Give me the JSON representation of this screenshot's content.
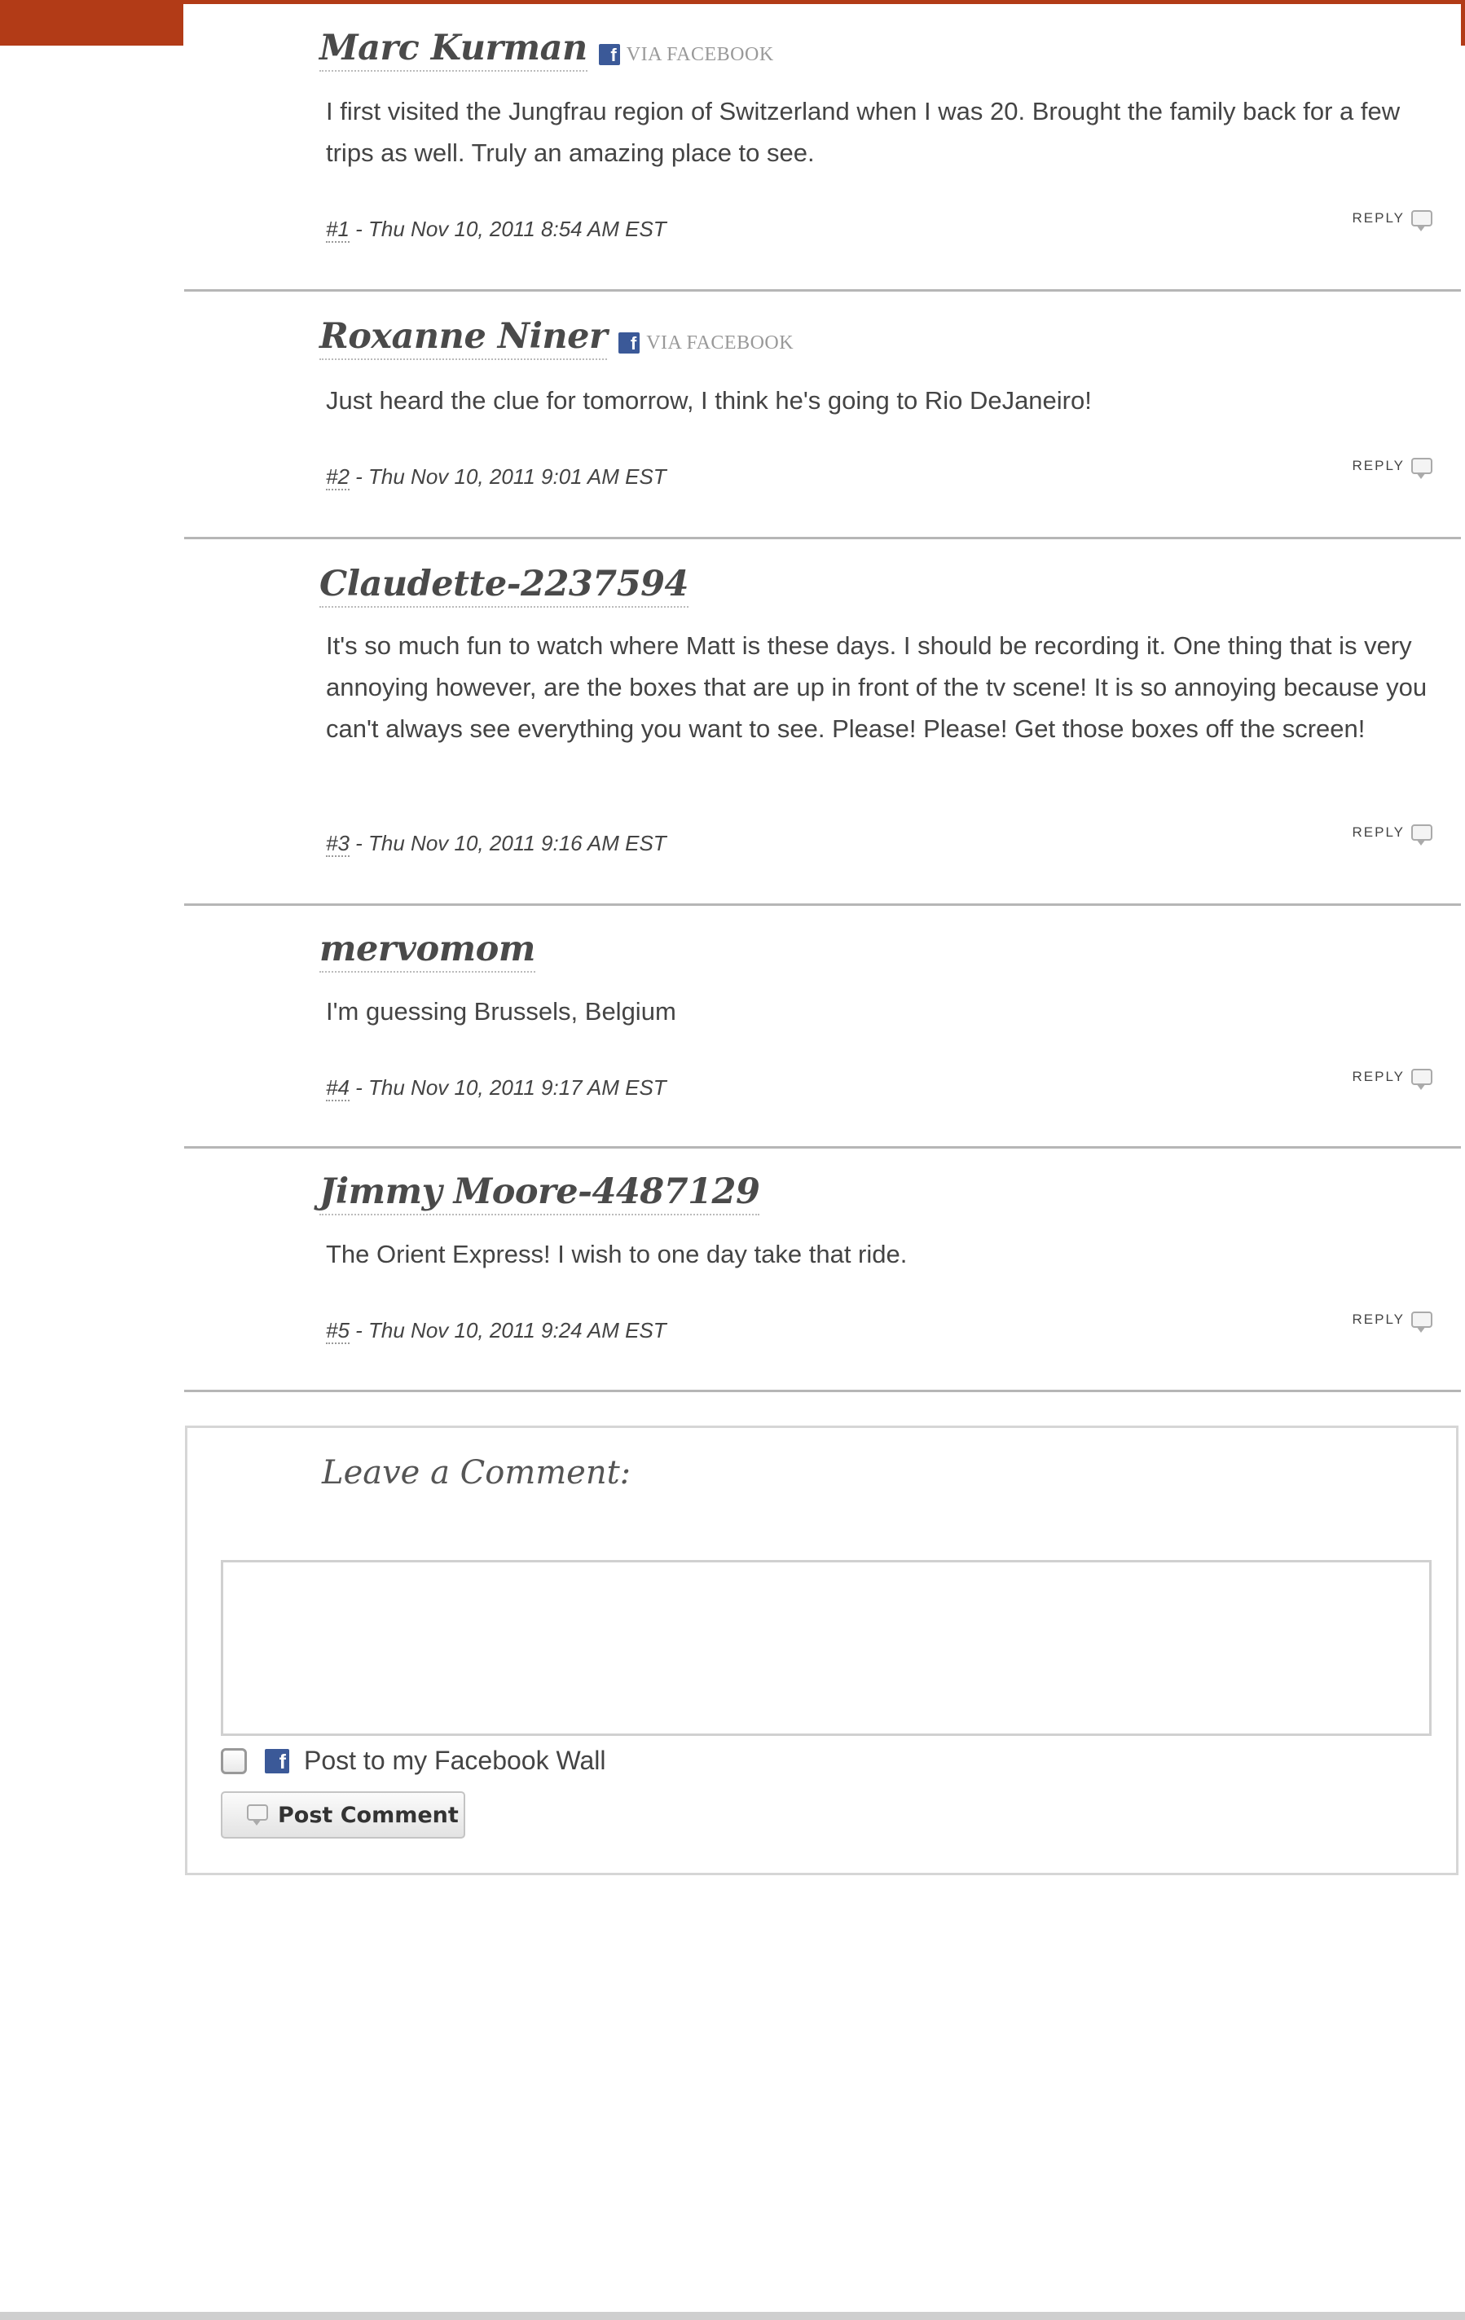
{
  "comments": [
    {
      "author": "Marc Kurman",
      "via": "VIA FACEBOOK",
      "body": "I first visited the Jungfrau region of Switzerland when I was 20. Brought the family back for a few trips as well. Truly an amazing place to see.",
      "number": "#1",
      "timestamp": " - Thu Nov 10, 2011 8:54 AM EST",
      "reply": "Reply"
    },
    {
      "author": "Roxanne Niner",
      "via": "VIA FACEBOOK",
      "body": "Just heard the clue for tomorrow, I think he's going to Rio DeJaneiro!",
      "number": "#2",
      "timestamp": " - Thu Nov 10, 2011 9:01 AM EST",
      "reply": "Reply"
    },
    {
      "author": "Claudette-2237594",
      "via": "",
      "body": "It's so much fun to watch where Matt is these days. I should be recording it. One thing that is very annoying however, are the boxes that are up in front of the tv scene! It is so annoying because you can't always see everything you want to see. Please! Please! Get those boxes off the screen!",
      "number": "#3",
      "timestamp": " - Thu Nov 10, 2011 9:16 AM EST",
      "reply": "Reply"
    },
    {
      "author": "mervomom",
      "via": "",
      "body": "I'm guessing Brussels, Belgium",
      "number": "#4",
      "timestamp": " - Thu Nov 10, 2011 9:17 AM EST",
      "reply": "Reply"
    },
    {
      "author": "Jimmy Moore-4487129",
      "via": "",
      "body": "The Orient Express! I wish to one day take that ride.",
      "number": "#5",
      "timestamp": " - Thu Nov 10, 2011 9:24 AM EST",
      "reply": "Reply"
    }
  ],
  "leave_comment": {
    "title": "Leave a Comment:",
    "textarea_value": "",
    "facebook_wall_label": "Post to my Facebook Wall",
    "facebook_wall_checked": false,
    "post_button_label": "Post Comment"
  },
  "colors": {
    "accent": "#b23b17",
    "facebook": "#3b5998",
    "divider": "#b6b6b6"
  },
  "icons": {
    "facebook": "facebook-icon",
    "reply": "speech-bubble-icon"
  }
}
